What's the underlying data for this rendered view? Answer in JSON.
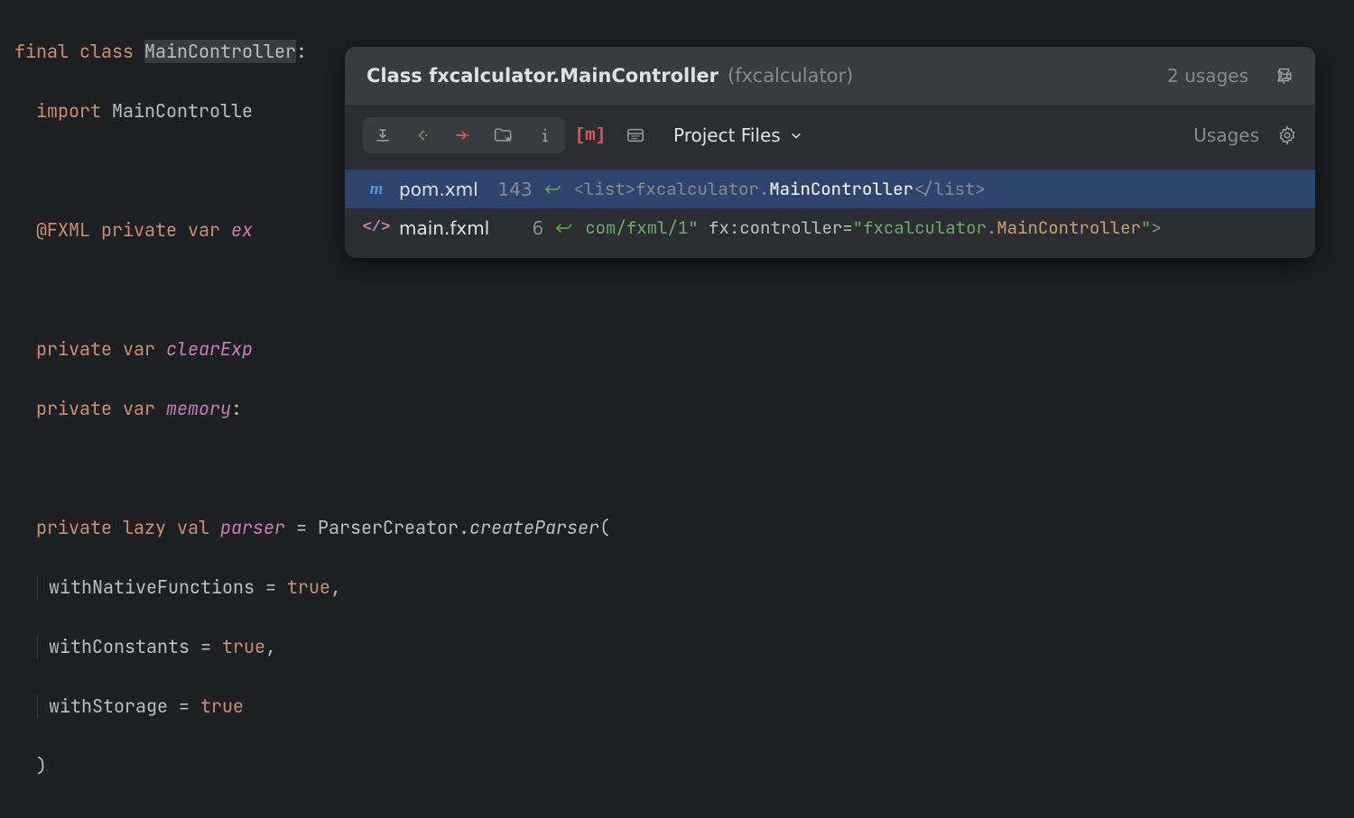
{
  "editor": {
    "line1": {
      "kw1": "final",
      "kw2": "class",
      "name": "MainController",
      "colon": ":"
    },
    "line2": {
      "kw": "import",
      "rest": "MainControlle"
    },
    "line4": {
      "ann": "@FXML",
      "kw1": "private",
      "kw2": "var",
      "name": "ex"
    },
    "line6": {
      "kw1": "private",
      "kw2": "var",
      "name": "clearExp"
    },
    "line7": {
      "kw1": "private",
      "kw2": "var",
      "name": "memory",
      "colon": ":"
    },
    "line9": {
      "kw1": "private",
      "kw2": "lazy",
      "kw3": "val",
      "name": "parser",
      "eq": " = ",
      "call1": "ParserCreator",
      "dot": ".",
      "call2": "createParser",
      "open": "("
    },
    "line10": {
      "prop": "withNativeFunctions",
      "eq": " = ",
      "val": "true",
      "comma": ","
    },
    "line11": {
      "prop": "withConstants",
      "eq": " = ",
      "val": "true",
      "comma": ","
    },
    "line12": {
      "prop": "withStorage",
      "eq": " = ",
      "val": "true"
    },
    "line13": {
      "close": ")"
    }
  },
  "popup": {
    "title_prefix": "Class ",
    "title_main": "fxcalculator.MainController",
    "title_sub": "(fxcalculator)",
    "usage_count": "2 usages",
    "scope": "Project Files",
    "usages_label": "Usages",
    "results": [
      {
        "selected": true,
        "icon_type": "maven",
        "file": "pom.xml",
        "line": "143",
        "preview_plain_pre": "<list>fxcalculator.",
        "preview_match": "MainController",
        "preview_plain_post": "</list>"
      },
      {
        "selected": false,
        "icon_type": "xml",
        "file": "main.fxml",
        "line": "6",
        "green1": "com/fxml/1\"",
        "attr": " fx:controller=",
        "green2": "\"fxcalculator.",
        "match": "MainController",
        "green3": "\"",
        "tail": ">"
      }
    ]
  }
}
